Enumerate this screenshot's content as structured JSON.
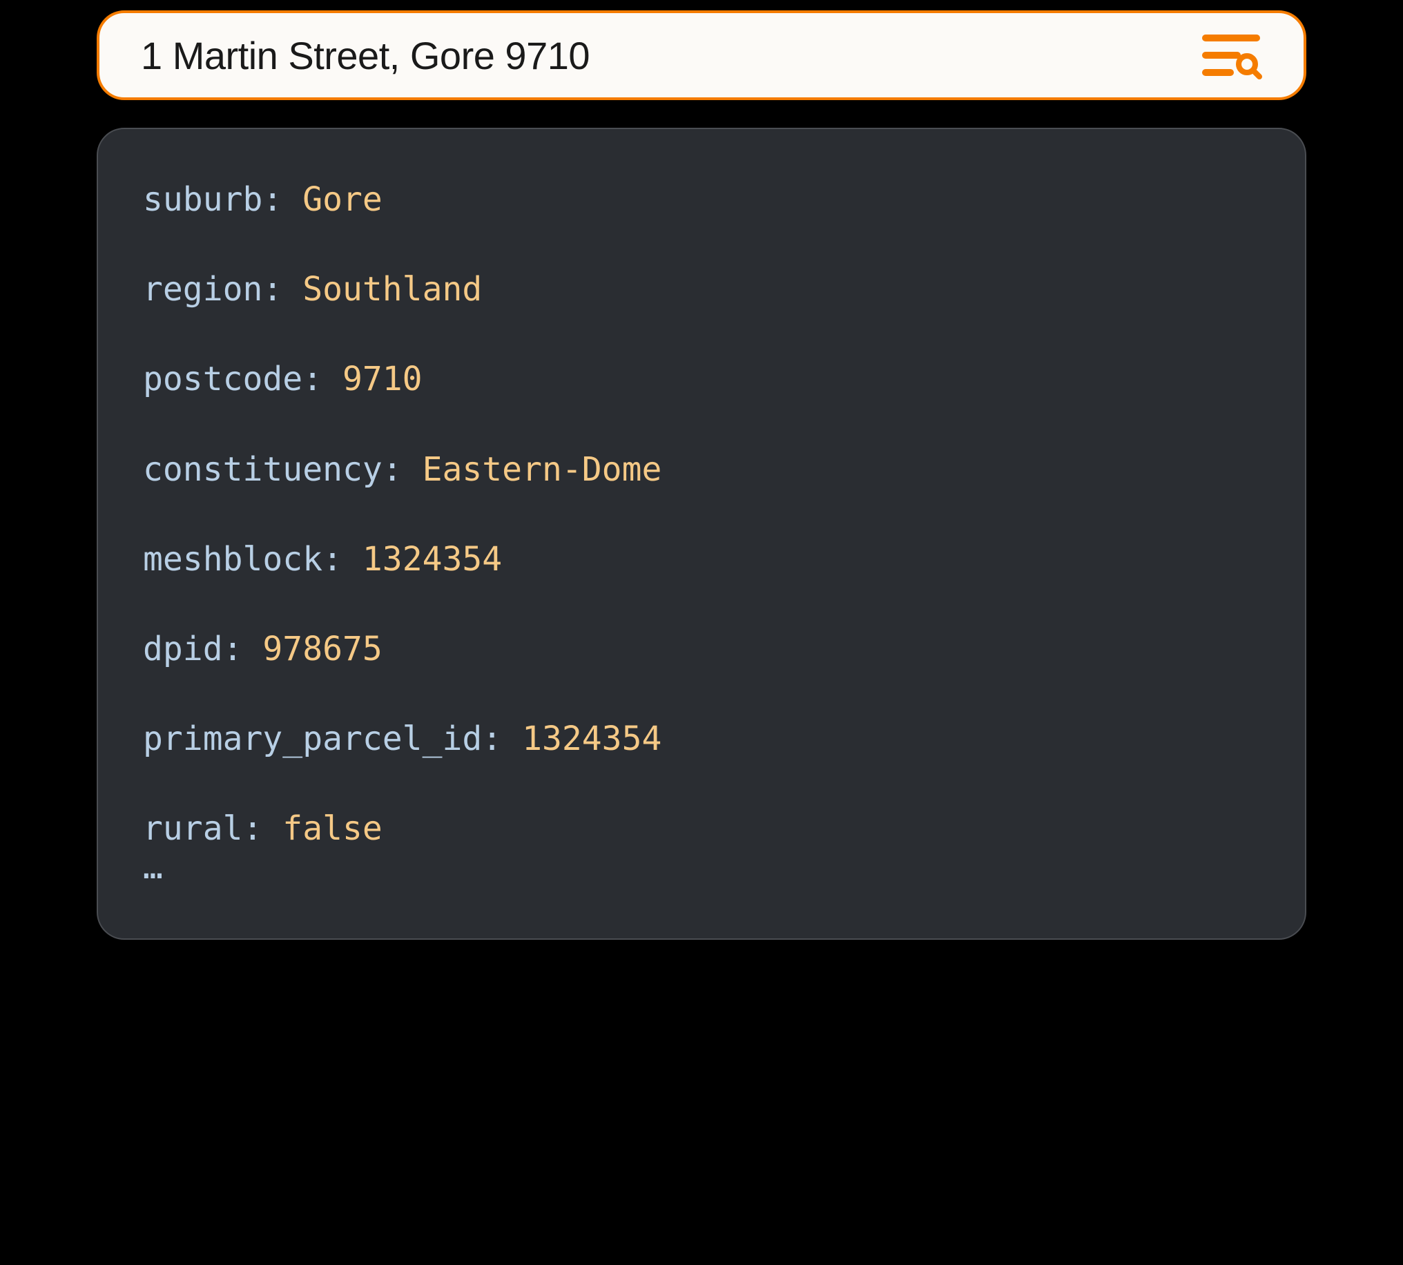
{
  "search": {
    "text": "1 Martin Street, Gore 9710"
  },
  "details": [
    {
      "key": "suburb",
      "value": "Gore"
    },
    {
      "key": "region",
      "value": "Southland"
    },
    {
      "key": "postcode",
      "value": "9710"
    },
    {
      "key": "constituency",
      "value": "Eastern-Dome"
    },
    {
      "key": "meshblock",
      "value": "1324354"
    },
    {
      "key": "dpid",
      "value": "978675"
    },
    {
      "key": "primary_parcel_id",
      "value": "1324354"
    },
    {
      "key": "rural",
      "value": "false"
    }
  ],
  "ellipsis": "…"
}
